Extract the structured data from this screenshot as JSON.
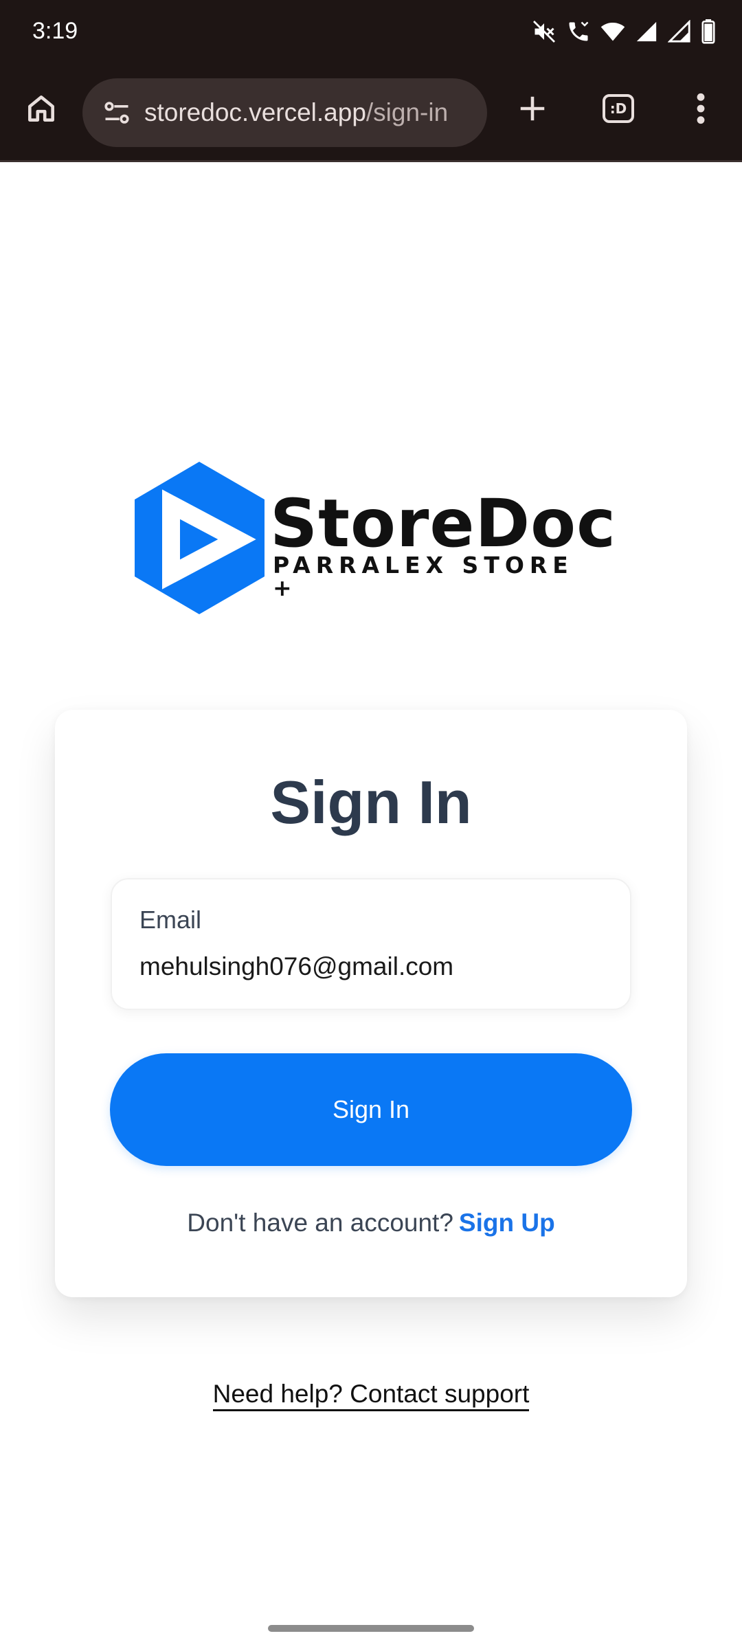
{
  "status_bar": {
    "time": "3:19",
    "icons": [
      "mute-icon",
      "call-icon",
      "wifi-icon",
      "signal-icon",
      "signal-icon",
      "battery-icon"
    ]
  },
  "browser": {
    "url_host": "storedoc.vercel.app",
    "url_path": "/sign-in",
    "tabs_label": ":D"
  },
  "logo": {
    "name": "StoreDoc",
    "tagline": "PARRALEX STORE +",
    "brand_color": "#0a78f5"
  },
  "sign_in_card": {
    "title": "Sign In",
    "email_label": "Email",
    "email_value": "mehulsingh076@gmail.com",
    "submit_label": "Sign In",
    "no_account_text": "Don't have an account?",
    "signup_link": "Sign Up"
  },
  "support": {
    "link_text": "Need help? Contact support"
  }
}
